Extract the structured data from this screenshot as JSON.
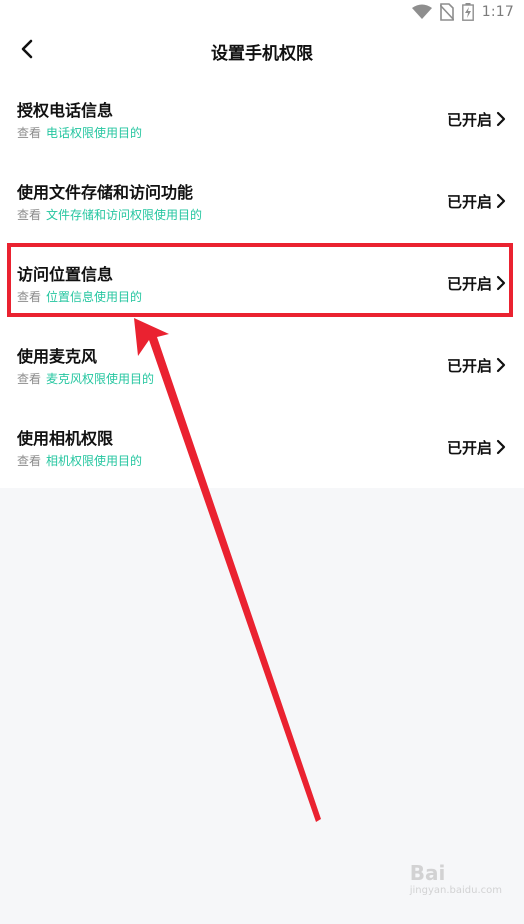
{
  "status_bar": {
    "time": "1:17",
    "icons": [
      "wifi-icon",
      "no-sim-icon",
      "battery-charging-icon"
    ]
  },
  "header": {
    "title": "设置手机权限",
    "back_icon": "chevron-left-icon"
  },
  "permissions": [
    {
      "title": "授权电话信息",
      "prefix": "查看",
      "link": "电话权限使用目的",
      "status": "已开启"
    },
    {
      "title": "使用文件存储和访问功能",
      "prefix": "查看",
      "link": "文件存储和访问权限使用目的",
      "status": "已开启"
    },
    {
      "title": "访问位置信息",
      "prefix": "查看",
      "link": "位置信息使用目的",
      "status": "已开启"
    },
    {
      "title": "使用麦克风",
      "prefix": "查看",
      "link": "麦克风权限使用目的",
      "status": "已开启"
    },
    {
      "title": "使用相机权限",
      "prefix": "查看",
      "link": "相机权限使用目的",
      "status": "已开启"
    }
  ],
  "annotation": {
    "highlighted_row": 2,
    "color": "#ea2230"
  },
  "watermark": {
    "text": "Bai",
    "sub": "jingyan.baidu.com"
  },
  "colors": {
    "link": "#25c6a0",
    "background": "#f6f7f9",
    "text": "#111111",
    "muted": "#8c8c8c"
  }
}
